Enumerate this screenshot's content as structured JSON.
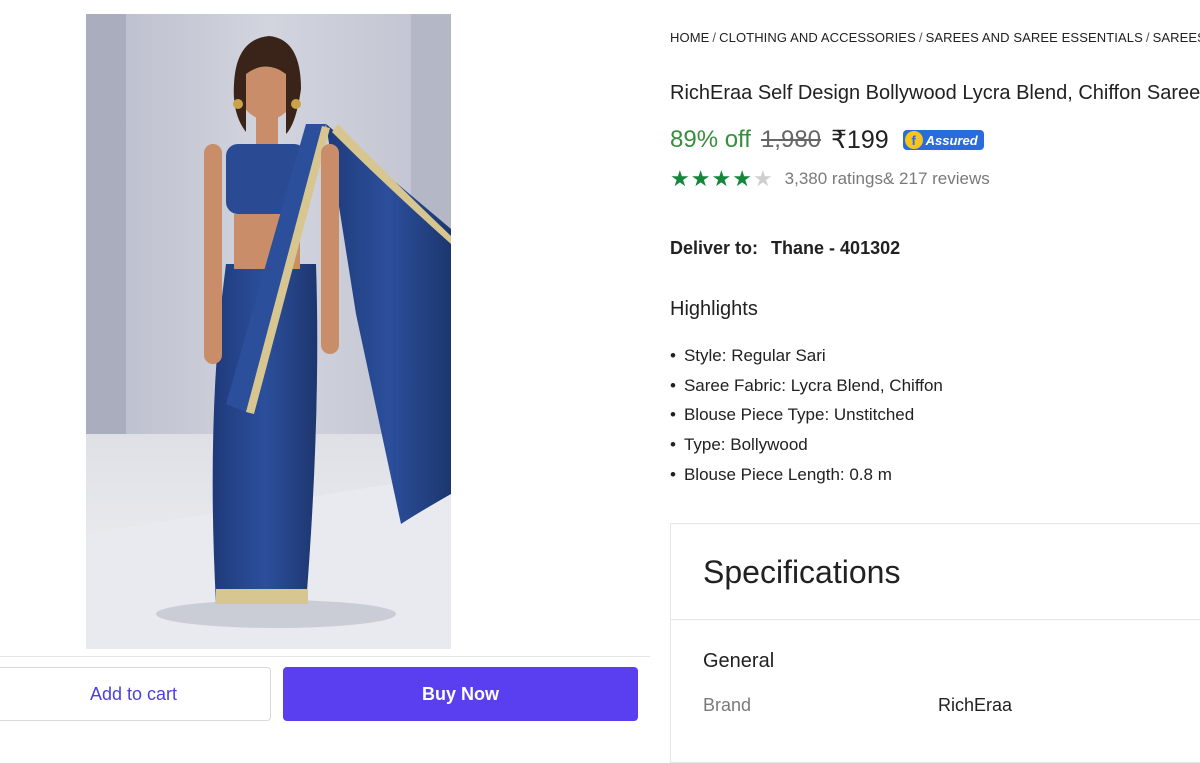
{
  "breadcrumb": [
    "HOME",
    "CLOTHING AND ACCESSORIES",
    "SAREES AND SAREE ESSENTIALS",
    "SAREES"
  ],
  "product": {
    "title": "RichEraa Self Design Bollywood Lycra Blend, Chiffon Saree",
    "discount": "89% off",
    "mrp": "1,980",
    "price": "₹199",
    "assured_badge": "Assured",
    "rating_value": 4,
    "ratings_count": "3,380 ratings",
    "reviews_count": "& 217 reviews"
  },
  "delivery": {
    "label": "Deliver to:",
    "location": "Thane - 401302"
  },
  "highlights": {
    "heading": "Highlights",
    "items": [
      "Style: Regular Sari",
      "Saree Fabric: Lycra Blend, Chiffon",
      "Blouse Piece Type: Unstitched",
      "Type: Bollywood",
      "Blouse Piece Length: 0.8 m"
    ]
  },
  "specifications": {
    "title": "Specifications",
    "section": "General",
    "rows": [
      {
        "key": "Brand",
        "value": "RichEraa"
      }
    ]
  },
  "actions": {
    "add_to_cart": "Add to cart",
    "buy_now": "Buy Now"
  },
  "colors": {
    "accent": "#5a3ff0",
    "discount": "#388e3c",
    "star": "#14873a",
    "assured": "#2a6cdb"
  }
}
